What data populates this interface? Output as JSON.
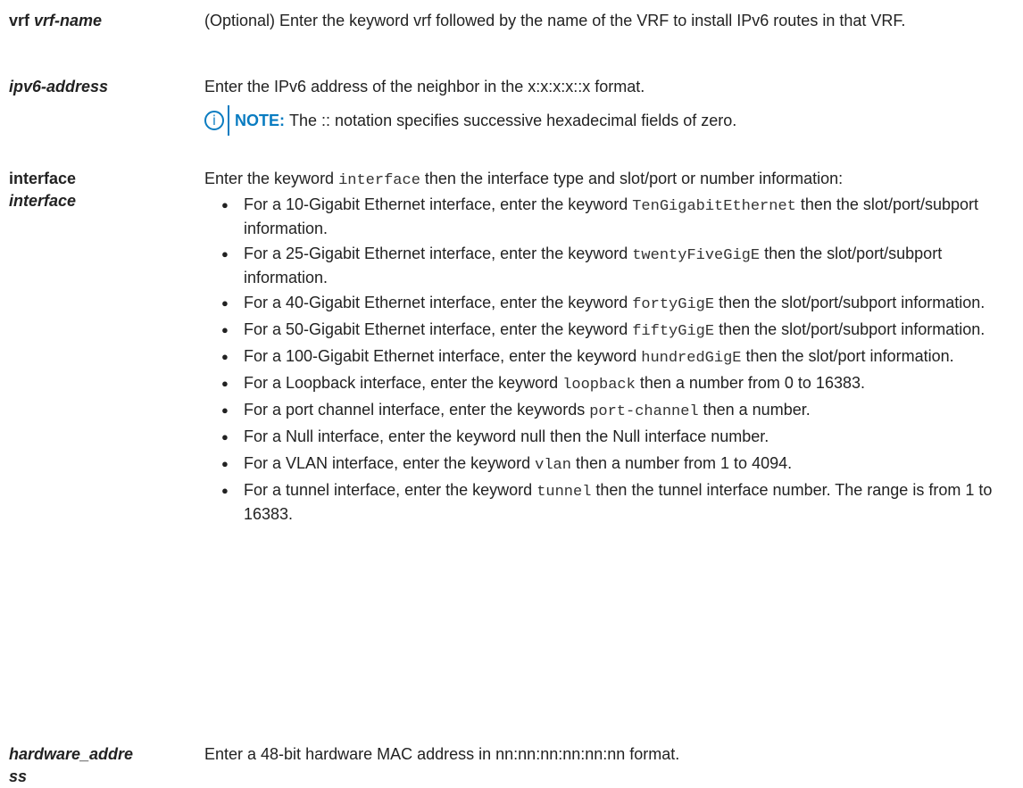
{
  "params": {
    "vrf": {
      "keyword": "vrf",
      "arg": "vrf-name",
      "desc": "(Optional) Enter the keyword vrf followed by the name of the VRF to install IPv6 routes in that VRF."
    },
    "ipv6": {
      "arg": "ipv6-address",
      "desc": "Enter the IPv6 address of the neighbor in the x:x:x:x::x format.",
      "note_label": "NOTE:",
      "note_text": "The :: notation specifies successive hexadecimal fields of zero.",
      "note_icon": "info-icon"
    },
    "interface": {
      "keyword": "interface",
      "arg": "interface",
      "desc_pre": "Enter the keyword ",
      "desc_code": "interface",
      "desc_post": " then the interface type and slot/port or number information:",
      "bullets": [
        {
          "pre": "For a 10-Gigabit Ethernet interface, enter the keyword ",
          "code": "TenGigabitEthernet",
          "post": " then the slot/port/subport information."
        },
        {
          "pre": "For a 25-Gigabit Ethernet interface, enter the keyword ",
          "code": "twentyFiveGigE",
          "post": " then the slot/port/subport information."
        },
        {
          "pre": "For a 40-Gigabit Ethernet interface, enter the keyword ",
          "code": "fortyGigE",
          "post": " then the slot/port/subport information."
        },
        {
          "pre": "For a 50-Gigabit Ethernet interface, enter the keyword ",
          "code": "fiftyGigE",
          "post": " then the slot/port/subport information."
        },
        {
          "pre": "For a 100-Gigabit Ethernet interface, enter the keyword ",
          "code": "hundredGigE",
          "post": " then the slot/port information."
        },
        {
          "pre": "For a Loopback interface, enter the keyword ",
          "code": "loopback",
          "post": " then a number from 0 to 16383."
        },
        {
          "pre": "For a port channel interface, enter the keywords ",
          "code": "port-channel",
          "post": " then a number."
        },
        {
          "pre": "For a Null interface, enter the keyword null then the Null interface number.",
          "code": "",
          "post": ""
        },
        {
          "pre": "For a VLAN interface, enter the keyword ",
          "code": "vlan",
          "post": " then a number from 1 to 4094."
        },
        {
          "pre": "For a tunnel interface, enter the keyword ",
          "code": "tunnel",
          "post": " then the tunnel interface number. The range is from 1 to 16383."
        }
      ]
    },
    "hardware": {
      "arg": "hardware_address",
      "desc": "Enter a 48-bit hardware MAC address in nn:nn:nn:nn:nn:nn format."
    }
  },
  "colors": {
    "accent": "#0a7cc1",
    "text": "#222222"
  }
}
